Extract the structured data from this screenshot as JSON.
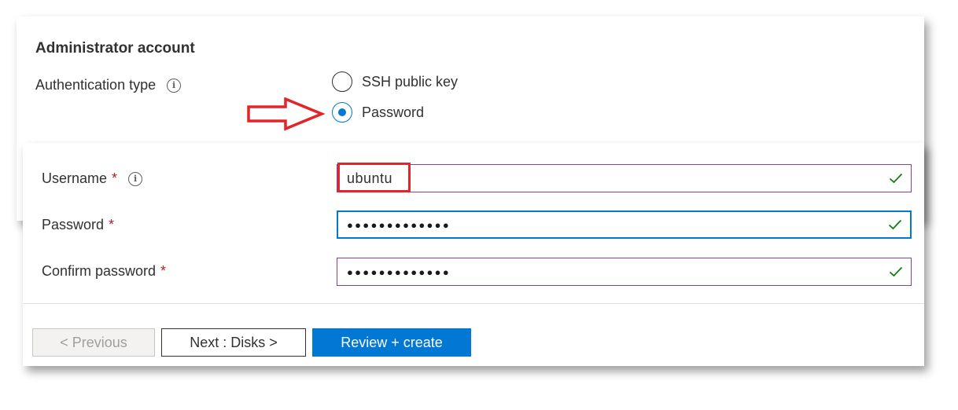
{
  "section": {
    "heading": "Administrator account"
  },
  "auth": {
    "label": "Authentication type",
    "options": [
      {
        "label": "SSH public key",
        "checked": false
      },
      {
        "label": "Password",
        "checked": true
      }
    ]
  },
  "fields": {
    "username": {
      "label": "Username",
      "required": "*",
      "value": "ubuntu"
    },
    "password": {
      "label": "Password",
      "required": "*",
      "value": "●●●●●●●●●●●●●"
    },
    "confirm": {
      "label": "Confirm password",
      "required": "*",
      "value": "●●●●●●●●●●●●●"
    }
  },
  "buttons": {
    "previous": "< Previous",
    "next": "Next : Disks >",
    "review": "Review + create"
  },
  "icons": {
    "info": "info-icon",
    "valid": "checkmark-icon",
    "annotation": "red-arrow"
  },
  "colors": {
    "accent": "#0078d4",
    "valid": "#107c10",
    "required": "#a4262c",
    "annotation": "#e3242b",
    "field_border": "#8a3f93"
  }
}
